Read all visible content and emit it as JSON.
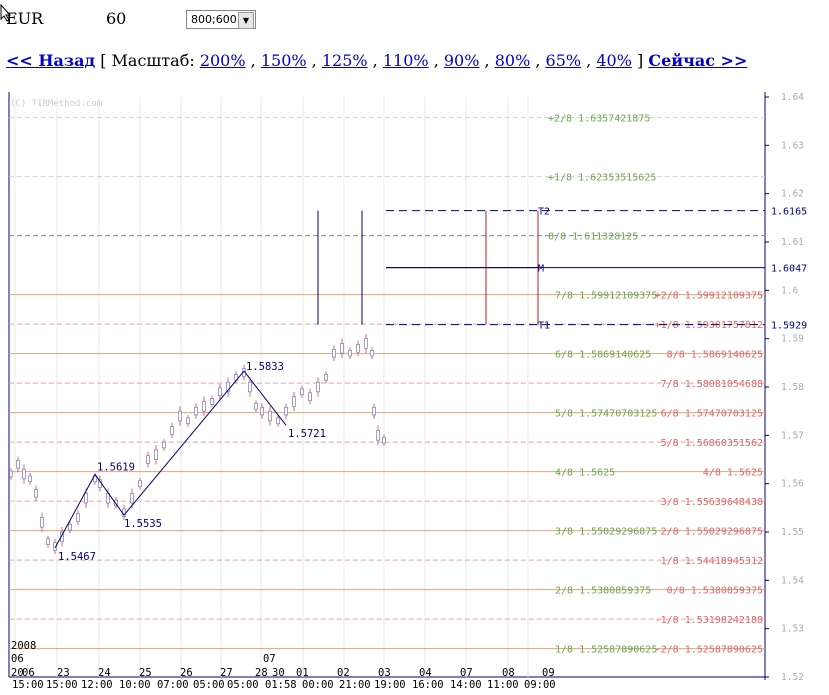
{
  "header": {
    "symbol": "EUR",
    "timeframe": "60",
    "size_select": {
      "value": "800;600"
    }
  },
  "nav": {
    "back_label": "<< Назад",
    "bracket_open": "[",
    "scale_label": "Масштаб:",
    "scales": [
      "200%",
      "150%",
      "125%",
      "110%",
      "90%",
      "80%",
      "65%",
      "40%"
    ],
    "bracket_close": "]",
    "now_label": "Сейчас >>"
  },
  "chart_data": {
    "type": "line",
    "copyright": "(C) TIRMethod.com",
    "ylim": [
      1.52,
      1.64
    ],
    "y_ticks": [
      "1.64",
      "1.63",
      "1.62",
      "1.61",
      "1.6",
      "1.59",
      "1.58",
      "1.57",
      "1.56",
      "1.55",
      "1.54",
      "1.53",
      "1.52"
    ],
    "x_day_labels": [
      "06",
      "23",
      "24",
      "25",
      "26",
      "27",
      "28",
      "30",
      "01",
      "02",
      "03",
      "04",
      "07",
      "08",
      "09"
    ],
    "x_time_labels": [
      "15:00",
      "15:00",
      "12:00",
      "10:00",
      "07:00",
      "05:00",
      "05:00",
      "01:58",
      "00:00",
      "21:00",
      "19:00",
      "16:00",
      "14:00",
      "11:00",
      "09:00"
    ],
    "x_extra_labels": {
      "year": "2008",
      "month_06": "06",
      "day_20": "20",
      "month_07": "07"
    },
    "levels_green": [
      {
        "label": "+2/8",
        "value": "1.6357421875"
      },
      {
        "label": "+1/8",
        "value": "1.62353515625"
      },
      {
        "label": "8/8",
        "value": "1.611328125"
      },
      {
        "label": "7/8",
        "value": "1.59912109375"
      },
      {
        "label": "6/8",
        "value": "1.5869140625"
      },
      {
        "label": "5/8",
        "value": "1.57470703125"
      },
      {
        "label": "4/8",
        "value": "1.5625"
      },
      {
        "label": "3/8",
        "value": "1.55029296875"
      },
      {
        "label": "2/8",
        "value": "1.5380859375"
      },
      {
        "label": "1/8",
        "value": "1.52587890625"
      }
    ],
    "levels_red": [
      {
        "label": "+2/8",
        "value": "1.59912109375"
      },
      {
        "label": "+1/8",
        "value": "1.59301757812"
      },
      {
        "label": "8/8",
        "value": "1.5869140625"
      },
      {
        "label": "7/8",
        "value": "1.58081054688"
      },
      {
        "label": "6/8",
        "value": "1.57470703125"
      },
      {
        "label": "5/8",
        "value": "1.56860351562"
      },
      {
        "label": "4/8",
        "value": "1.5625"
      },
      {
        "label": "3/8",
        "value": "1.55639648438"
      },
      {
        "label": "2/8",
        "value": "1.55029296875"
      },
      {
        "label": "1/8",
        "value": "1.54418945312"
      },
      {
        "label": "0/8",
        "value": "1.5380859375"
      },
      {
        "label": "-1/8",
        "value": "1.53198242188"
      },
      {
        "label": "-2/8",
        "value": "1.52587890625"
      }
    ],
    "markers": [
      {
        "label": "T2",
        "value": "1.6165"
      },
      {
        "label": "M",
        "value": "1.6047"
      },
      {
        "label": "T1",
        "value": "1.5929"
      }
    ],
    "zigzag": [
      {
        "label": "1.5619",
        "value": 1.5619
      },
      {
        "label": "1.5467",
        "value": 1.5467
      },
      {
        "label": "1.5535",
        "value": 1.5535
      },
      {
        "label": "1.5833",
        "value": 1.5833
      },
      {
        "label": "1.5721",
        "value": 1.5721
      }
    ],
    "colors": {
      "green": "#6aa84f",
      "red": "#e06666",
      "navy": "#00007f",
      "darkred": "#b22222"
    }
  }
}
